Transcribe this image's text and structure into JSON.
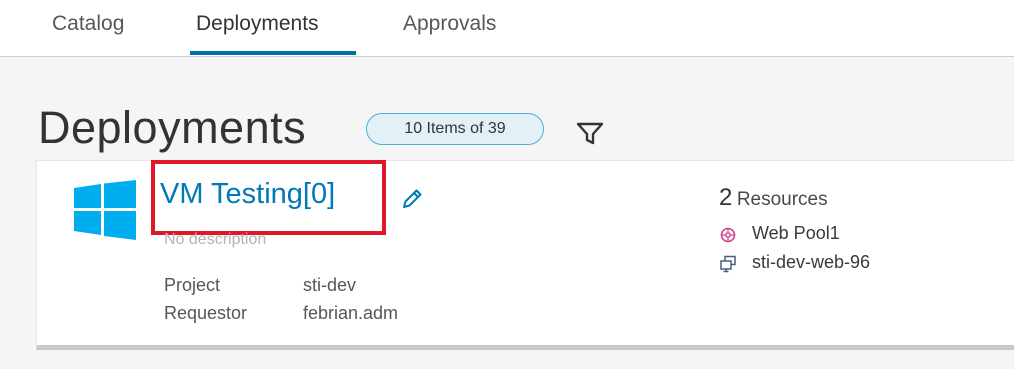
{
  "tabs": [
    {
      "label": "Catalog",
      "active": false
    },
    {
      "label": "Deployments",
      "active": true
    },
    {
      "label": "Approvals",
      "active": false
    }
  ],
  "page": {
    "title": "Deployments",
    "count_badge": "10 Items of 39",
    "filter_icon": "filter-icon"
  },
  "deployment": {
    "icon": "windows-logo-icon",
    "name": "VM Testing[0]",
    "description": "No description",
    "project_label": "Project",
    "project_value": "sti-dev",
    "requestor_label": "Requestor",
    "requestor_value": "febrian.adm",
    "resources_count": "2",
    "resources_label": "Resources",
    "resources": [
      {
        "icon": "load-balancer-icon",
        "name": "Web Pool1"
      },
      {
        "icon": "virtual-machine-icon",
        "name": "sti-dev-web-96"
      }
    ]
  },
  "colors": {
    "accent": "#0072a3",
    "link": "#0079b8",
    "highlight": "#e0162b",
    "badge_border": "#49afd9",
    "windows_blue": "#00adef"
  }
}
